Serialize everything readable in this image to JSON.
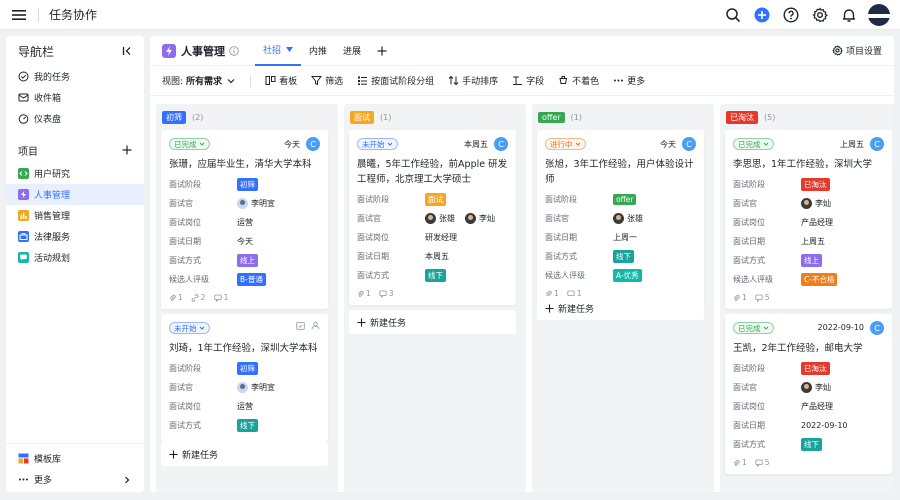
{
  "app": {
    "title": "任务协作"
  },
  "sidebar": {
    "title": "导航栏",
    "nav": [
      {
        "label": "我的任务",
        "icon": "check-circle-icon"
      },
      {
        "label": "收件箱",
        "icon": "inbox-icon"
      },
      {
        "label": "仪表盘",
        "icon": "dashboard-icon"
      }
    ],
    "group_title": "项目",
    "projects": [
      {
        "label": "用户研究",
        "color": "#34a853"
      },
      {
        "label": "人事管理",
        "color": "#8d6cf0",
        "active": true
      },
      {
        "label": "销售管理",
        "color": "#f5a623"
      },
      {
        "label": "法律服务",
        "color": "#3370ff"
      },
      {
        "label": "活动规划",
        "color": "#14b8a6"
      }
    ],
    "footer": [
      {
        "label": "模板库"
      },
      {
        "label": "更多"
      }
    ]
  },
  "project": {
    "title": "人事管理",
    "tabs": [
      {
        "label": "社招",
        "active": true
      },
      {
        "label": "内推"
      },
      {
        "label": "进展"
      }
    ],
    "settings_label": "项目设置"
  },
  "toolbar": {
    "view_label": "视图:",
    "view_value": "所有需求",
    "items": [
      {
        "label": "看板"
      },
      {
        "label": "筛选"
      },
      {
        "label": "按面试阶段分组"
      },
      {
        "label": "手动排序"
      },
      {
        "label": "字段"
      },
      {
        "label": "不着色"
      },
      {
        "label": "更多"
      }
    ]
  },
  "colors": {
    "blue": "#3370ff",
    "green": "#34a853",
    "orange": "#f5a623",
    "red": "#e5392c",
    "purple": "#8d6cf0",
    "teal": "#14b8a6",
    "cyan": "#1aa39a"
  },
  "labels": {
    "stage": "面试阶段",
    "interviewer": "面试官",
    "position": "面试岗位",
    "date": "面试日期",
    "method": "面试方式",
    "rating": "候选人评级",
    "new_task": "新建任务"
  },
  "columns": [
    {
      "tag": "初筛",
      "count": "(2)",
      "color": "#3370ff",
      "cards": [
        {
          "status": "已完成",
          "due": "今天",
          "avatar": "C",
          "title": "张珊，应届毕业生，清华大学本科",
          "stage": "初筛",
          "interviewer": "李明宣",
          "position": "运营",
          "date": "今天",
          "method": "线上",
          "rating": "B-普通",
          "meta": {
            "attach": "1",
            "subtask": "2",
            "comment": "1"
          }
        },
        {
          "status": "未开始",
          "title": "刘琦，1年工作经验，深圳大学本科",
          "stage": "初筛",
          "interviewer": "李明宣",
          "position": "运营",
          "method": "线下"
        }
      ]
    },
    {
      "tag": "面试",
      "count": "(1)",
      "color": "#f5a623",
      "cards": [
        {
          "status": "未开始",
          "due": "本周五",
          "avatar": "C",
          "title": "晨曦，5年工作经验，前Apple 研发工程师，北京理工大学硕士",
          "stage": "面试",
          "interviewer1": "张雄",
          "interviewer2": "李灿",
          "position": "研发经理",
          "date": "本周五",
          "method": "线下",
          "meta": {
            "attach": "1",
            "comment": "3"
          }
        }
      ]
    },
    {
      "tag": "offer",
      "count": "(1)",
      "color": "#34a853",
      "cards": [
        {
          "status": "进行中",
          "due": "今天",
          "avatar": "C",
          "title": "张旭，3年工作经验，用户体验设计师",
          "stage": "offer",
          "interviewer": "张雄",
          "date": "上周一",
          "method": "线下",
          "rating": "A-优秀",
          "meta": {
            "attach": "1",
            "comment": "1"
          }
        }
      ]
    },
    {
      "tag": "已淘汰",
      "count": "(5)",
      "color": "#e5392c",
      "cards": [
        {
          "status": "已完成",
          "due": "上周五",
          "avatar": "C",
          "title": "李思思，1年工作经验，深圳大学",
          "stage": "已淘汰",
          "interviewer": "李灿",
          "position": "产品经理",
          "date": "上周五",
          "method": "线上",
          "rating": "C-不合格",
          "meta": {
            "attach": "1",
            "comment": "5"
          }
        },
        {
          "status": "已完成",
          "due": "2022-09-10",
          "avatar": "C",
          "title": "王凯，2年工作经验，邮电大学",
          "stage": "已淘汰",
          "interviewer": "李灿",
          "position": "产品经理",
          "date": "2022-09-10",
          "method": "线下",
          "meta": {
            "attach": "1",
            "comment": "5"
          }
        }
      ]
    }
  ]
}
